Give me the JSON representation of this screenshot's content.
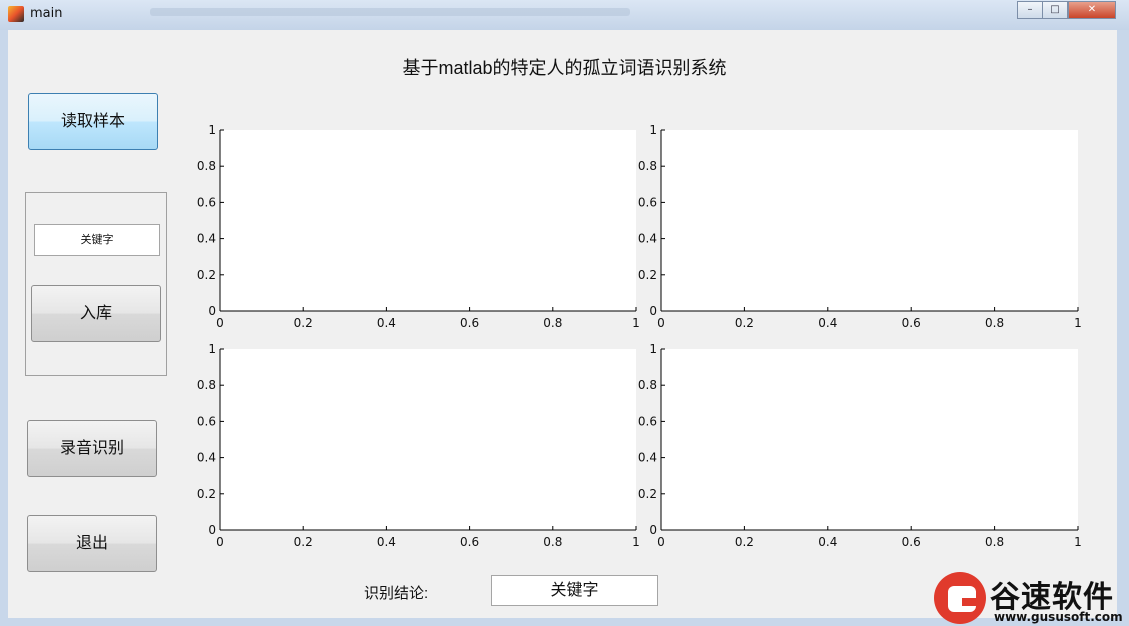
{
  "window": {
    "title": "main"
  },
  "title": "基于matlab的特定人的孤立词语识别系统",
  "buttons": {
    "read_samples": "读取样本",
    "store": "入库",
    "record_recognize": "录音识别",
    "exit": "退出"
  },
  "keyword_input": {
    "value": "关键字"
  },
  "result": {
    "label": "识别结论:",
    "value": "关键字"
  },
  "axes_ticks": {
    "x": [
      "0",
      "0.2",
      "0.4",
      "0.6",
      "0.8",
      "1"
    ],
    "y": [
      "0",
      "0.2",
      "0.4",
      "0.6",
      "0.8",
      "1"
    ]
  },
  "watermark": {
    "text": "谷速软件",
    "url": "www.gususoft.com"
  }
}
